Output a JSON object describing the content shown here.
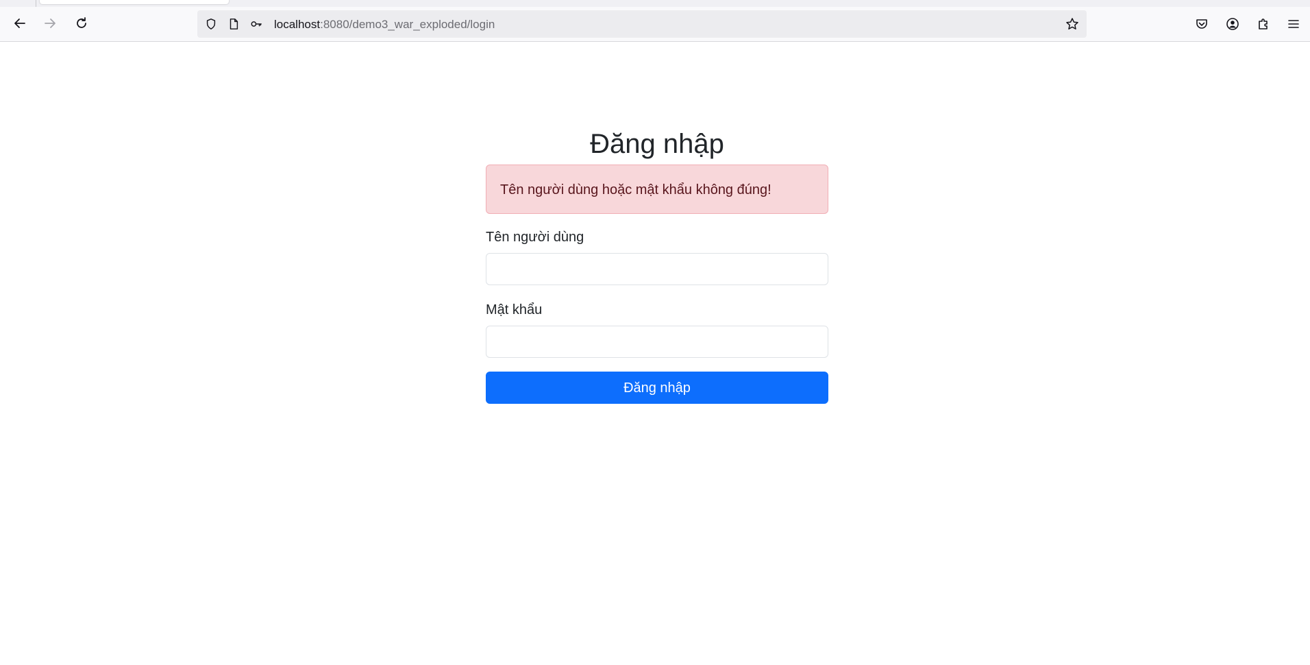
{
  "browser": {
    "url_host": "localhost",
    "url_path": ":8080/demo3_war_exploded/login",
    "icons": {
      "back": "back-arrow-icon",
      "forward": "forward-arrow-icon",
      "reload": "reload-icon",
      "shield": "tracking-protection-shield-icon",
      "page": "page-info-icon",
      "key": "key-icon",
      "star": "bookmark-star-icon",
      "pocket": "pocket-icon",
      "account": "account-icon",
      "extensions": "extensions-icon",
      "menu": "hamburger-menu-icon"
    }
  },
  "login": {
    "title": "Đăng nhập",
    "error_message": "Tên người dùng hoặc mật khẩu không đúng!",
    "username_label": "Tên người dùng",
    "username_value": "",
    "password_label": "Mật khẩu",
    "password_value": "",
    "submit_label": "Đăng nhập"
  },
  "colors": {
    "primary": "#0d6efd",
    "alert_bg": "#f8d7da",
    "alert_text": "#58151c",
    "alert_border": "#f1aeb5"
  }
}
